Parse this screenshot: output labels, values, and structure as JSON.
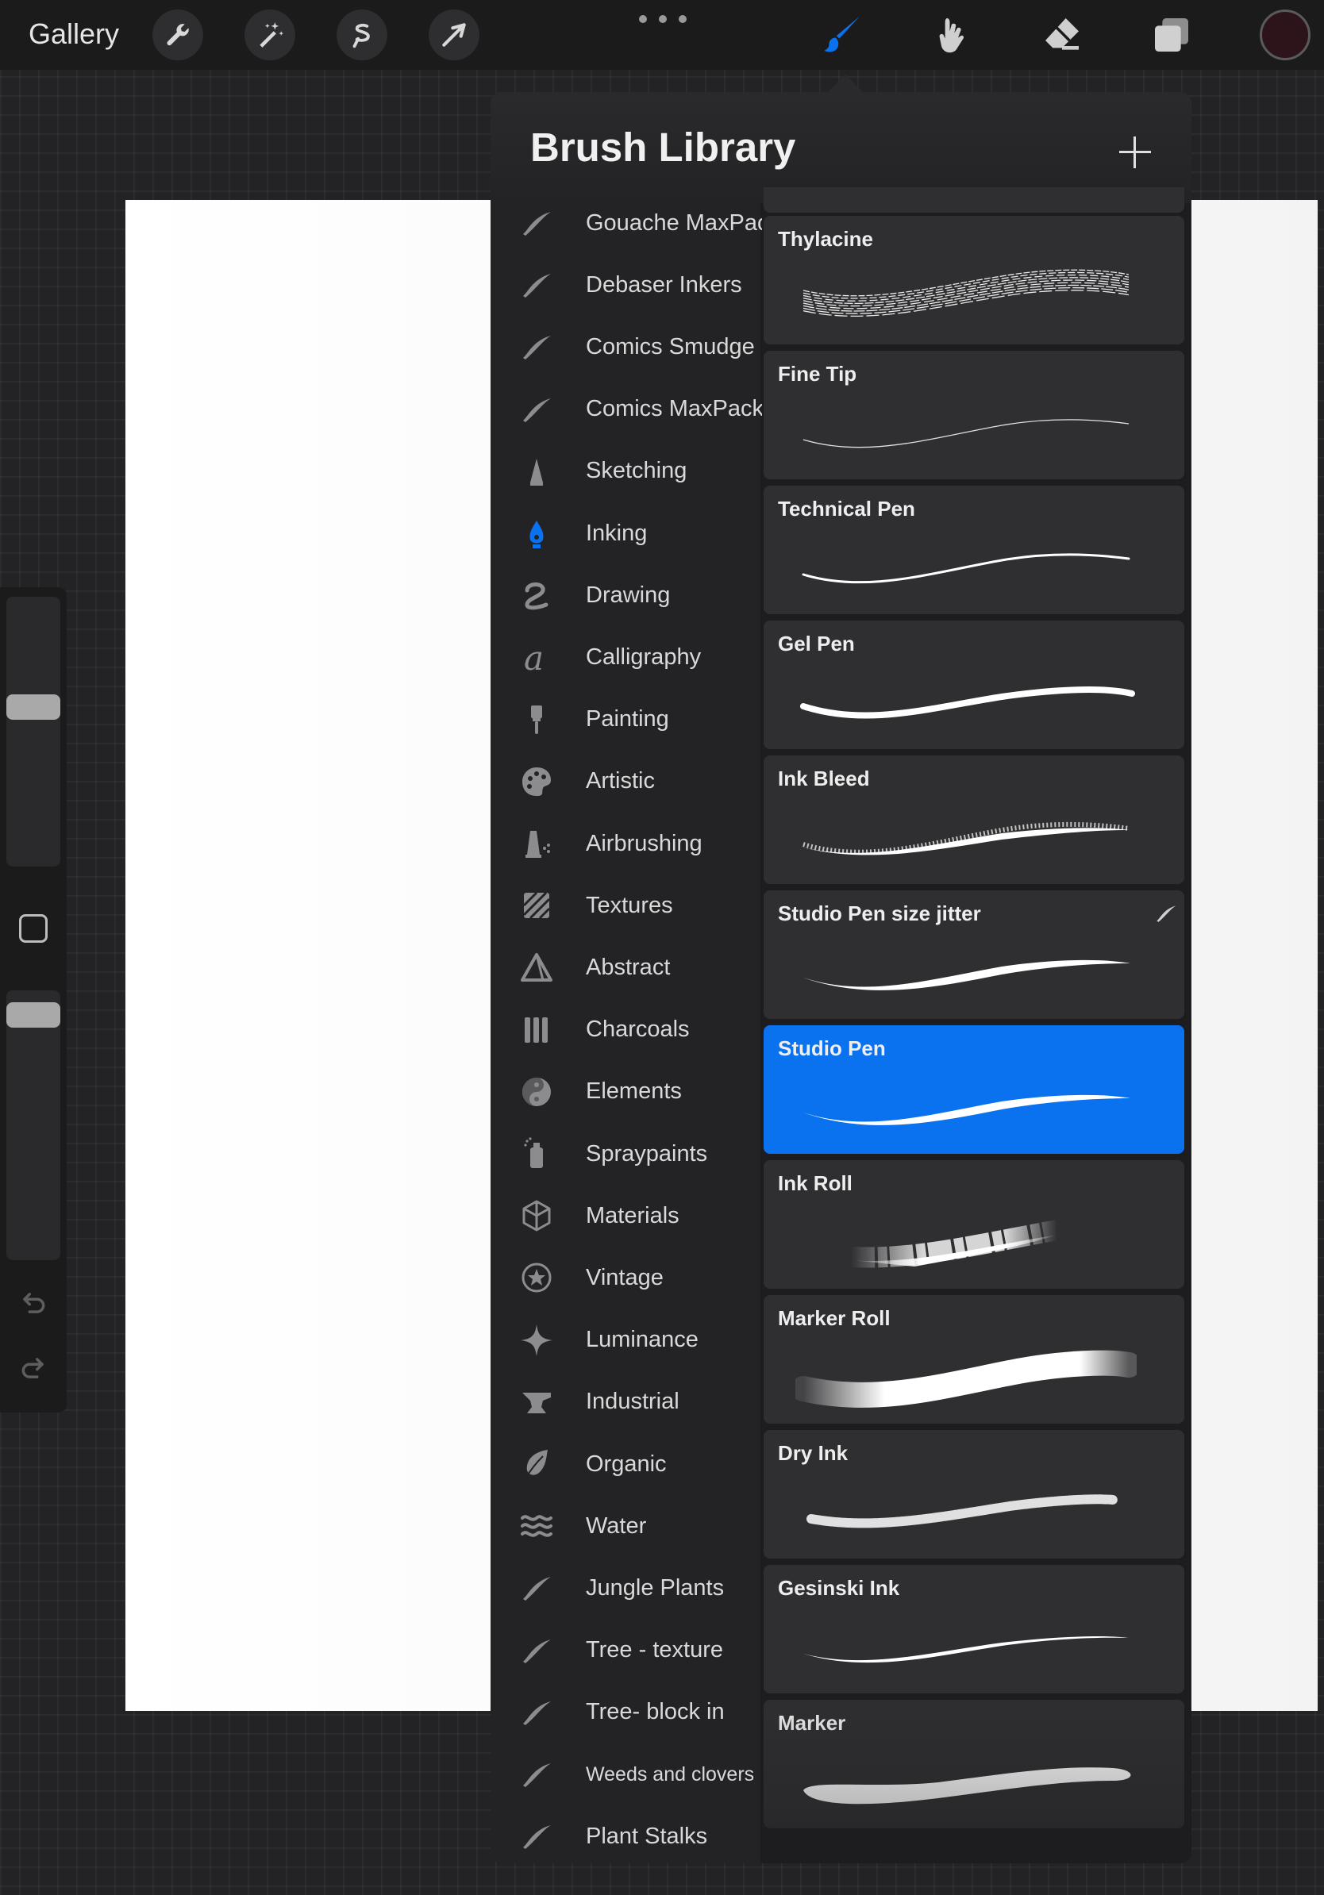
{
  "toolbar": {
    "gallery_label": "Gallery",
    "tools": [
      "wrench-icon",
      "magic-wand-icon",
      "selection-icon",
      "transform-arrow-icon"
    ],
    "right_tools": [
      "brush-icon",
      "smudge-icon",
      "eraser-icon",
      "layers-icon"
    ],
    "active_tool": "brush",
    "active_color": "#0a72ee",
    "current_color": "#2d141b"
  },
  "sidebar": {
    "brush_size_level": 0.6,
    "opacity_level": 0.95
  },
  "brush_library": {
    "title": "Brush Library",
    "sets": [
      {
        "label": "Gouache MaxPack",
        "icon": "brush-stroke-icon"
      },
      {
        "label": "Debaser Inkers",
        "icon": "brush-stroke-icon"
      },
      {
        "label": "Comics Smudge",
        "icon": "brush-stroke-icon"
      },
      {
        "label": "Comics MaxPack",
        "icon": "brush-stroke-icon"
      },
      {
        "label": "Sketching",
        "icon": "pencil-tip-icon"
      },
      {
        "label": "Inking",
        "icon": "pen-nib-icon"
      },
      {
        "label": "Drawing",
        "icon": "squiggle-icon"
      },
      {
        "label": "Calligraphy",
        "icon": "calligraphy-a-icon"
      },
      {
        "label": "Painting",
        "icon": "paintbrush-icon"
      },
      {
        "label": "Artistic",
        "icon": "palette-icon"
      },
      {
        "label": "Airbrushing",
        "icon": "airbrush-icon"
      },
      {
        "label": "Textures",
        "icon": "texture-hatch-icon"
      },
      {
        "label": "Abstract",
        "icon": "triangle-icon"
      },
      {
        "label": "Charcoals",
        "icon": "charcoal-sticks-icon"
      },
      {
        "label": "Elements",
        "icon": "yin-yang-icon"
      },
      {
        "label": "Spraypaints",
        "icon": "spray-can-icon"
      },
      {
        "label": "Materials",
        "icon": "cube-icon"
      },
      {
        "label": "Vintage",
        "icon": "star-badge-icon"
      },
      {
        "label": "Luminance",
        "icon": "sparkle-icon"
      },
      {
        "label": "Industrial",
        "icon": "anvil-icon"
      },
      {
        "label": "Organic",
        "icon": "leaf-icon"
      },
      {
        "label": "Water",
        "icon": "waves-icon"
      },
      {
        "label": "Jungle Plants",
        "icon": "brush-stroke-icon"
      },
      {
        "label": "Tree - texture",
        "icon": "brush-stroke-icon"
      },
      {
        "label": "Tree- block in",
        "icon": "brush-stroke-icon"
      },
      {
        "label": "Weeds and clovers",
        "icon": "brush-stroke-icon"
      },
      {
        "label": "Plant Stalks",
        "icon": "brush-stroke-icon"
      }
    ],
    "active_set": "Inking",
    "brushes": [
      {
        "name": "Thylacine",
        "stroke": "hatched"
      },
      {
        "name": "Fine Tip",
        "stroke": "hairline"
      },
      {
        "name": "Technical Pen",
        "stroke": "thin"
      },
      {
        "name": "Gel Pen",
        "stroke": "medium"
      },
      {
        "name": "Ink Bleed",
        "stroke": "rough"
      },
      {
        "name": "Studio Pen size jitter",
        "stroke": "tapered",
        "imported": true
      },
      {
        "name": "Studio Pen",
        "stroke": "tapered",
        "selected": true
      },
      {
        "name": "Ink Roll",
        "stroke": "dry-roll"
      },
      {
        "name": "Marker Roll",
        "stroke": "soft-wide"
      },
      {
        "name": "Dry Ink",
        "stroke": "speckled"
      },
      {
        "name": "Gesinski Ink",
        "stroke": "thin-taper"
      },
      {
        "name": "Marker",
        "stroke": "bold"
      }
    ]
  }
}
